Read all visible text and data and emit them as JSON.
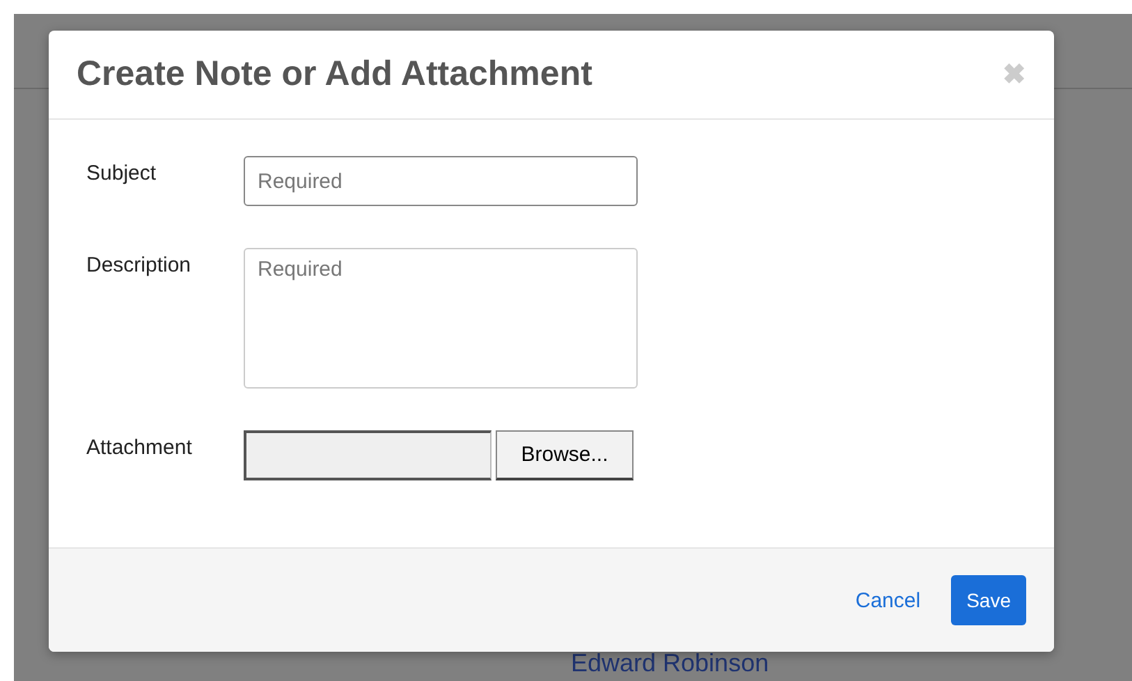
{
  "background": {
    "person_name": "Edward Robinson"
  },
  "dialog": {
    "title": "Create Note or Add Attachment",
    "close": "✖",
    "fields": [
      {
        "kind": "text",
        "label": "Subject",
        "placeholder": "Required"
      },
      {
        "kind": "textarea",
        "label": "Description",
        "placeholder": "Required"
      },
      {
        "kind": "file",
        "label": "Attachment",
        "button": "Browse..."
      }
    ],
    "buttons": [
      {
        "kind": "link",
        "label": "Cancel"
      },
      {
        "kind": "primary",
        "label": "Save"
      }
    ]
  }
}
